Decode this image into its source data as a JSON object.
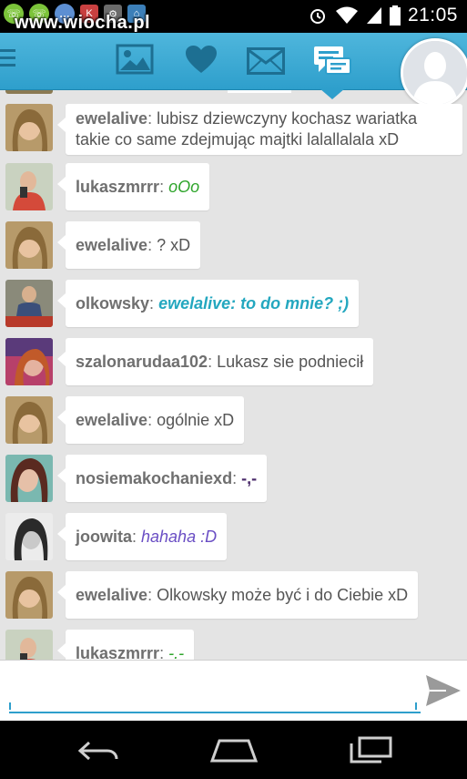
{
  "status_bar": {
    "time": "21:05",
    "left_icons": [
      "viber-icon",
      "viber-icon",
      "chat-icon",
      "notification-icon",
      "app-icon",
      "image-icon"
    ],
    "right_icons": [
      "alarm-icon",
      "wifi-icon",
      "signal-icon",
      "battery-icon"
    ]
  },
  "watermark": "www.wiocha.pl",
  "toolbar": {
    "icons": [
      "menu-icon",
      "gallery-icon",
      "heart-icon",
      "mail-icon",
      "chat-icon",
      "profile-avatar"
    ],
    "active_tab": "chat-icon",
    "accent": "#2e9fcc"
  },
  "messages": [
    {
      "user": "ewelalive",
      "sep": ": ",
      "text": "lubisz dziewczyny kochasz wariatka takie co same zdejmując majtki lalallalala xD",
      "style": "plain"
    },
    {
      "user": "lukaszmrrr",
      "sep": ": ",
      "text": "oOo",
      "style": "green"
    },
    {
      "user": "ewelalive",
      "sep": ": ",
      "text": "? xD",
      "style": "plain"
    },
    {
      "user": "olkowsky",
      "sep": ": ",
      "text": "ewelalive: to do mnie? ;)",
      "style": "teal"
    },
    {
      "user": "szalonarudaa102",
      "sep": ": ",
      "text": "Lukasz sie podniecił",
      "style": "plain"
    },
    {
      "user": "ewelalive",
      "sep": ": ",
      "text": "ogólnie xD",
      "style": "plain"
    },
    {
      "user": "nosiemakochaniexd",
      "sep": ": ",
      "text": "-,-",
      "style": "dark"
    },
    {
      "user": "joowita",
      "sep": ": ",
      "text": "hahaha :D",
      "style": "purple"
    },
    {
      "user": "ewelalive",
      "sep": ": ",
      "text": "Olkowsky może być i do Ciebie xD",
      "style": "plain"
    },
    {
      "user": "lukaszmrrr",
      "sep": ": ",
      "text": "-.-",
      "style": "green"
    }
  ],
  "input": {
    "value": "",
    "placeholder": ""
  },
  "nav_bar": {
    "icons": [
      "back-icon",
      "home-icon",
      "recent-apps-icon"
    ]
  }
}
